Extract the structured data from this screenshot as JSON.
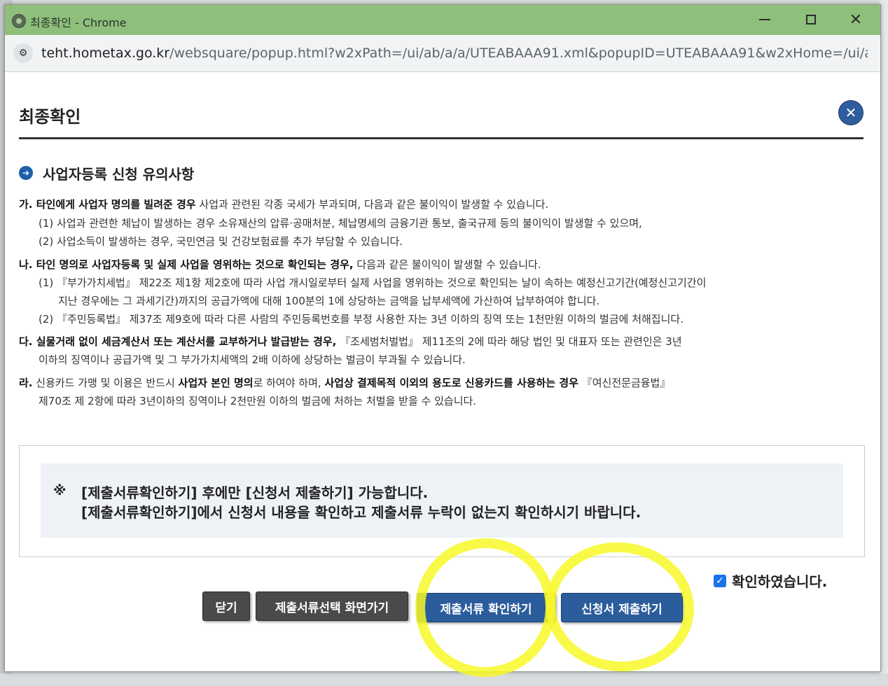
{
  "window": {
    "title": "최종확인 - Chrome",
    "minimize_icon": "minimize-icon",
    "maximize_icon": "maximize-icon",
    "close_icon": "close-icon",
    "close_glyph": "✕"
  },
  "address_bar": {
    "host": "teht.hometax.go.kr",
    "path": "/websquare/popup.html?w2xPath=/ui/ab/a/a/UTEABAAA91.xml&popupID=UTEABAAA91&w2xHome=/ui/ab...",
    "site_info_icon": "site-info-icon",
    "site_info_glyph": "⚙"
  },
  "dialog": {
    "title": "최종확인",
    "close_glyph": "✕",
    "section_title": "사업자등록 신청 유의사항",
    "section_bullet": "➔",
    "notes": {
      "ga_bold": "가. 타인에게 사업자 명의를 빌려준 경우",
      "ga_rest": " 사업과 관련된 각종 국세가 부과되며, 다음과 같은 불이익이 발생할 수 있습니다.",
      "ga_1": "(1) 사업과 관련한 체납이 발생하는 경우 소유재산의 압류·공매처분, 체납명세의 금융기관 통보, 출국규제 등의 불이익이 발생할 수 있으며,",
      "ga_2": "(2) 사업소득이 발생하는 경우, 국민연금 및 건강보험료를 추가 부담할 수 있습니다.",
      "na_bold": "나. 타인 명의로 사업자등록 및 실제 사업을 영위하는 것으로 확인되는 경우,",
      "na_rest": " 다음과 같은 불이익이 발생할 수 있습니다.",
      "na_1a": "(1)  『부가가치세법』 제22조 제1항 제2호에 따라 사업 개시일로부터 실제 사업을 영위하는 것으로 확인되는 날이 속하는 예정신고기간(예정신고기간이",
      "na_1b": "지난 경우에는 그 과세기간)까지의 공급가액에 대해 100분의 1에 상당하는 금액을 납부세액에 가산하여 납부하여야 합니다.",
      "na_2": "(2)  『주민등록법』 제37조 제9호에 따라 다른 사람의 주민등록번호를 부정 사용한 자는 3년 이하의 징역 또는 1천만원 이하의 벌금에 처해집니다.",
      "da_bold": "다. 실물거래 없이 세금계산서 또는 계산서를 교부하거나 발급받는 경우,",
      "da_rest": " 『조세범처벌법』 제11조의 2에 따라 해당 법인 및 대표자 또는 관련인은 3년",
      "da_2": "이하의 징역이나 공급가액 및 그 부가가치세액의 2배 이하에 상당하는 벌금이 부과될 수 있습니다.",
      "ra_label": "라.",
      "ra_a": " 신용카드 가맹 및 이용은 반드시 ",
      "ra_b": "사업자 본인 명의",
      "ra_c": "로 하여야 하며, ",
      "ra_d": "사업상 결제목적 이외의 용도로 신용카드를 사용하는 경우",
      "ra_e": " 『여신전문금융법』",
      "ra_2": "제70조 제 2항에 따라 3년이하의 징역이나 2천만원 이하의 벌금에 처하는 처벌을 받을 수 있습니다."
    },
    "notice": {
      "mark": "※",
      "line1": "[제출서류확인하기] 후에만 [신청서 제출하기] 가능합니다.",
      "line2": "[제출서류확인하기]에서 신청서 내용을 확인하고 제출서류 누락이 없는지 확인하시기 바랍니다."
    },
    "confirm_checkbox": {
      "label": "확인하였습니다.",
      "checked": true,
      "glyph": "✓"
    },
    "buttons": {
      "close": "닫기",
      "select_docs": "제출서류선택 화면가기",
      "check_docs": "제출서류 확인하기",
      "submit": "신청서 제출하기"
    }
  },
  "colors": {
    "titlebar": "#8ec07c",
    "primary_button": "#2b5c9c",
    "dark_button": "#4a4a4a",
    "highlight": "#f8f828"
  }
}
